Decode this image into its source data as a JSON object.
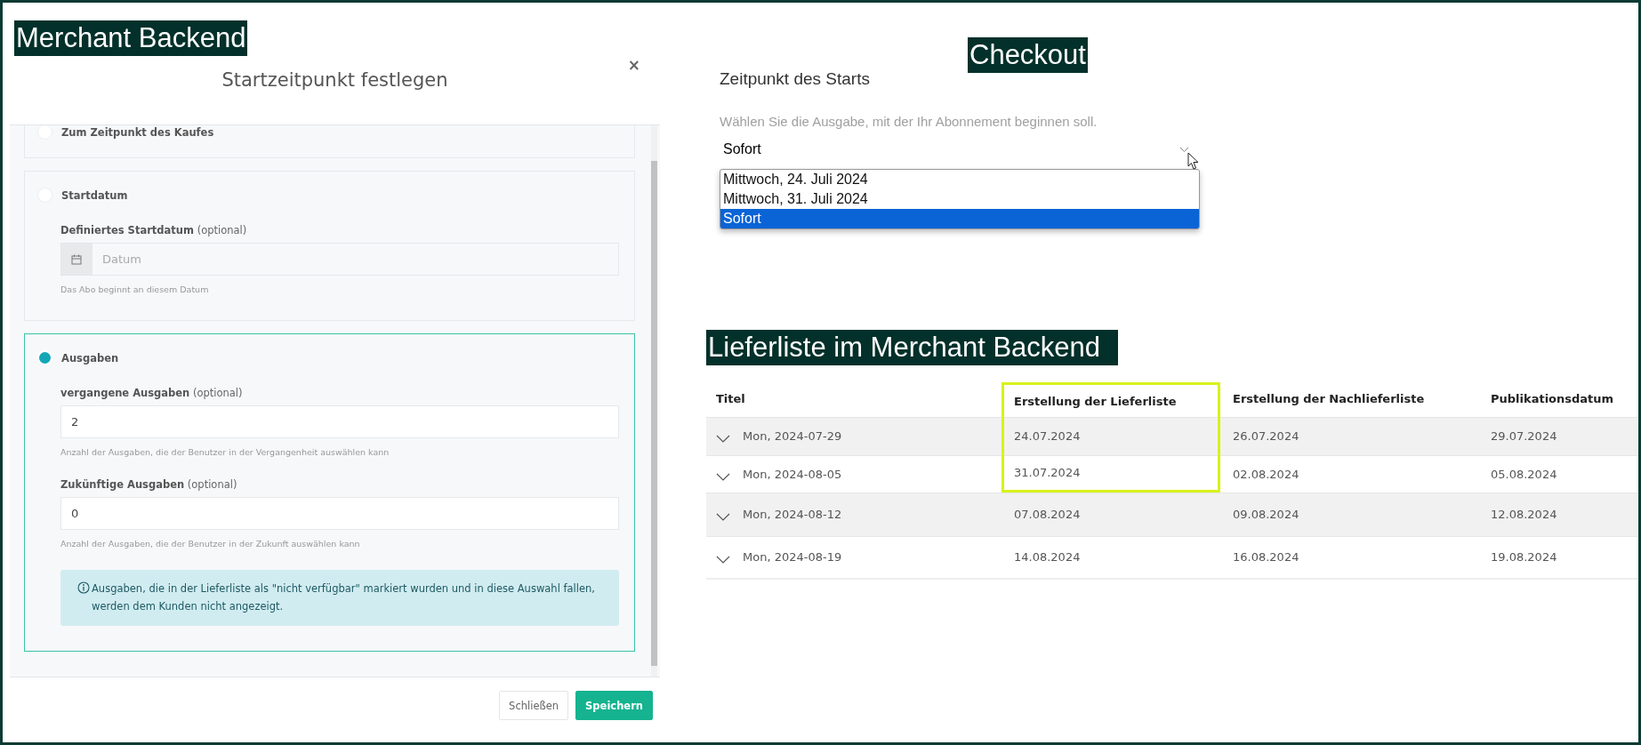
{
  "backend": {
    "caption": "Merchant Backend",
    "title": "Startzeitpunkt festlegen",
    "close": "×",
    "options": [
      {
        "label": "Zum Zeitpunkt des Kaufes",
        "selected": false
      },
      {
        "label": "Startdatum",
        "selected": false,
        "fields": [
          {
            "kind": "date",
            "label": "Definiertes Startdatum",
            "optional": "(optional)",
            "placeholder": "Datum",
            "help": "Das Abo beginnt an diesem Datum"
          }
        ]
      },
      {
        "label": "Ausgaben",
        "selected": true,
        "fields": [
          {
            "kind": "number",
            "label": "vergangene Ausgaben",
            "optional": "(optional)",
            "value": "2",
            "help": "Anzahl der Ausgaben, die der Benutzer in der Vergangenheit auswählen kann"
          },
          {
            "kind": "number",
            "label": "Zukünftige Ausgaben",
            "optional": "(optional)",
            "value": "0",
            "help": "Anzahl der Ausgaben, die der Benutzer in der Zukunft auswählen kann"
          },
          {
            "kind": "info",
            "text": "Ausgaben, die in der Lieferliste als \"nicht verfügbar\" markiert wurden und in diese Auswahl fallen, werden dem Kunden nicht angezeigt."
          }
        ]
      }
    ],
    "buttons": [
      {
        "label": "Schließen",
        "kind": "secondary"
      },
      {
        "label": "Speichern",
        "kind": "primary"
      }
    ]
  },
  "checkout": {
    "caption": "Checkout",
    "heading": "Zeitpunkt des Starts",
    "hint": "Wählen Sie die Ausgabe, mit der Ihr Abonnement beginnen soll.",
    "select": {
      "value": "Sofort",
      "expanded": true,
      "options": [
        {
          "label": "Mittwoch, 24. Juli 2024",
          "selected": false
        },
        {
          "label": "Mittwoch, 31. Juli 2024",
          "selected": false
        },
        {
          "label": "Sofort",
          "selected": true
        }
      ]
    }
  },
  "delivery_list": {
    "caption": "Lieferliste im Merchant Backend",
    "columns": [
      {
        "label": "Titel",
        "highlighted": false
      },
      {
        "label": "Erstellung der Lieferliste",
        "highlighted": true
      },
      {
        "label": "Erstellung der Nachlieferliste",
        "highlighted": false
      },
      {
        "label": "Publikationsdatum",
        "highlighted": false
      }
    ],
    "rows": [
      {
        "cells": [
          "Mon, 2024-07-29",
          "24.07.2024",
          "26.07.2024",
          "29.07.2024"
        ],
        "highlighted": true
      },
      {
        "cells": [
          "Mon, 2024-08-05",
          "31.07.2024",
          "02.08.2024",
          "05.08.2024"
        ],
        "highlighted": true
      },
      {
        "cells": [
          "Mon, 2024-08-12",
          "07.08.2024",
          "09.08.2024",
          "12.08.2024"
        ],
        "highlighted": false
      },
      {
        "cells": [
          "Mon, 2024-08-19",
          "14.08.2024",
          "16.08.2024",
          "19.08.2024"
        ],
        "highlighted": false
      }
    ]
  }
}
